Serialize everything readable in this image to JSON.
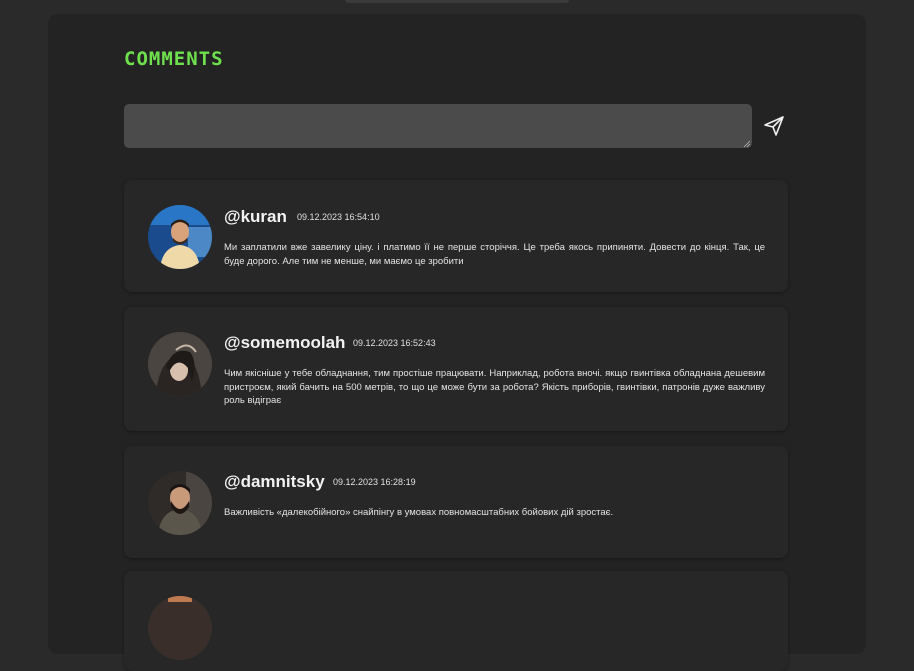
{
  "section": {
    "title": "COMMENTS"
  },
  "comment_form": {
    "input_value": "",
    "send_icon": "send-icon"
  },
  "comments": [
    {
      "username": "@kuran",
      "timestamp": "09.12.2023 16:54:10",
      "text": "Ми заплатили вже завелику ціну. і платимо її не перше сторіччя. Це треба якось припиняти. Довести до кінця. Так, це буде дорого. Але тим не менше, ми маємо це зробити"
    },
    {
      "username": "@somemoolah",
      "timestamp": "09.12.2023 16:52:43",
      "text": "Чим якісніше у тебе обладнання, тим простіше працювати. Наприклад, робота вночі. якщо гвинтівка обладнана дешевим пристроєм, який бачить на 500 метрів, то що це може бути за робота? Якість приборів, гвинтівки, патронів дуже важливу роль відіграє"
    },
    {
      "username": "@damnitsky",
      "timestamp": "09.12.2023 16:28:19",
      "text": "Важливість «далекобійного» снайпінгу в умовах повномасштабних бойових дій зростає."
    }
  ],
  "colors": {
    "accent": "#6ee04e",
    "background": "#2a2a2a",
    "panel": "#232323",
    "card": "#272727",
    "input": "#4b4b4b"
  }
}
